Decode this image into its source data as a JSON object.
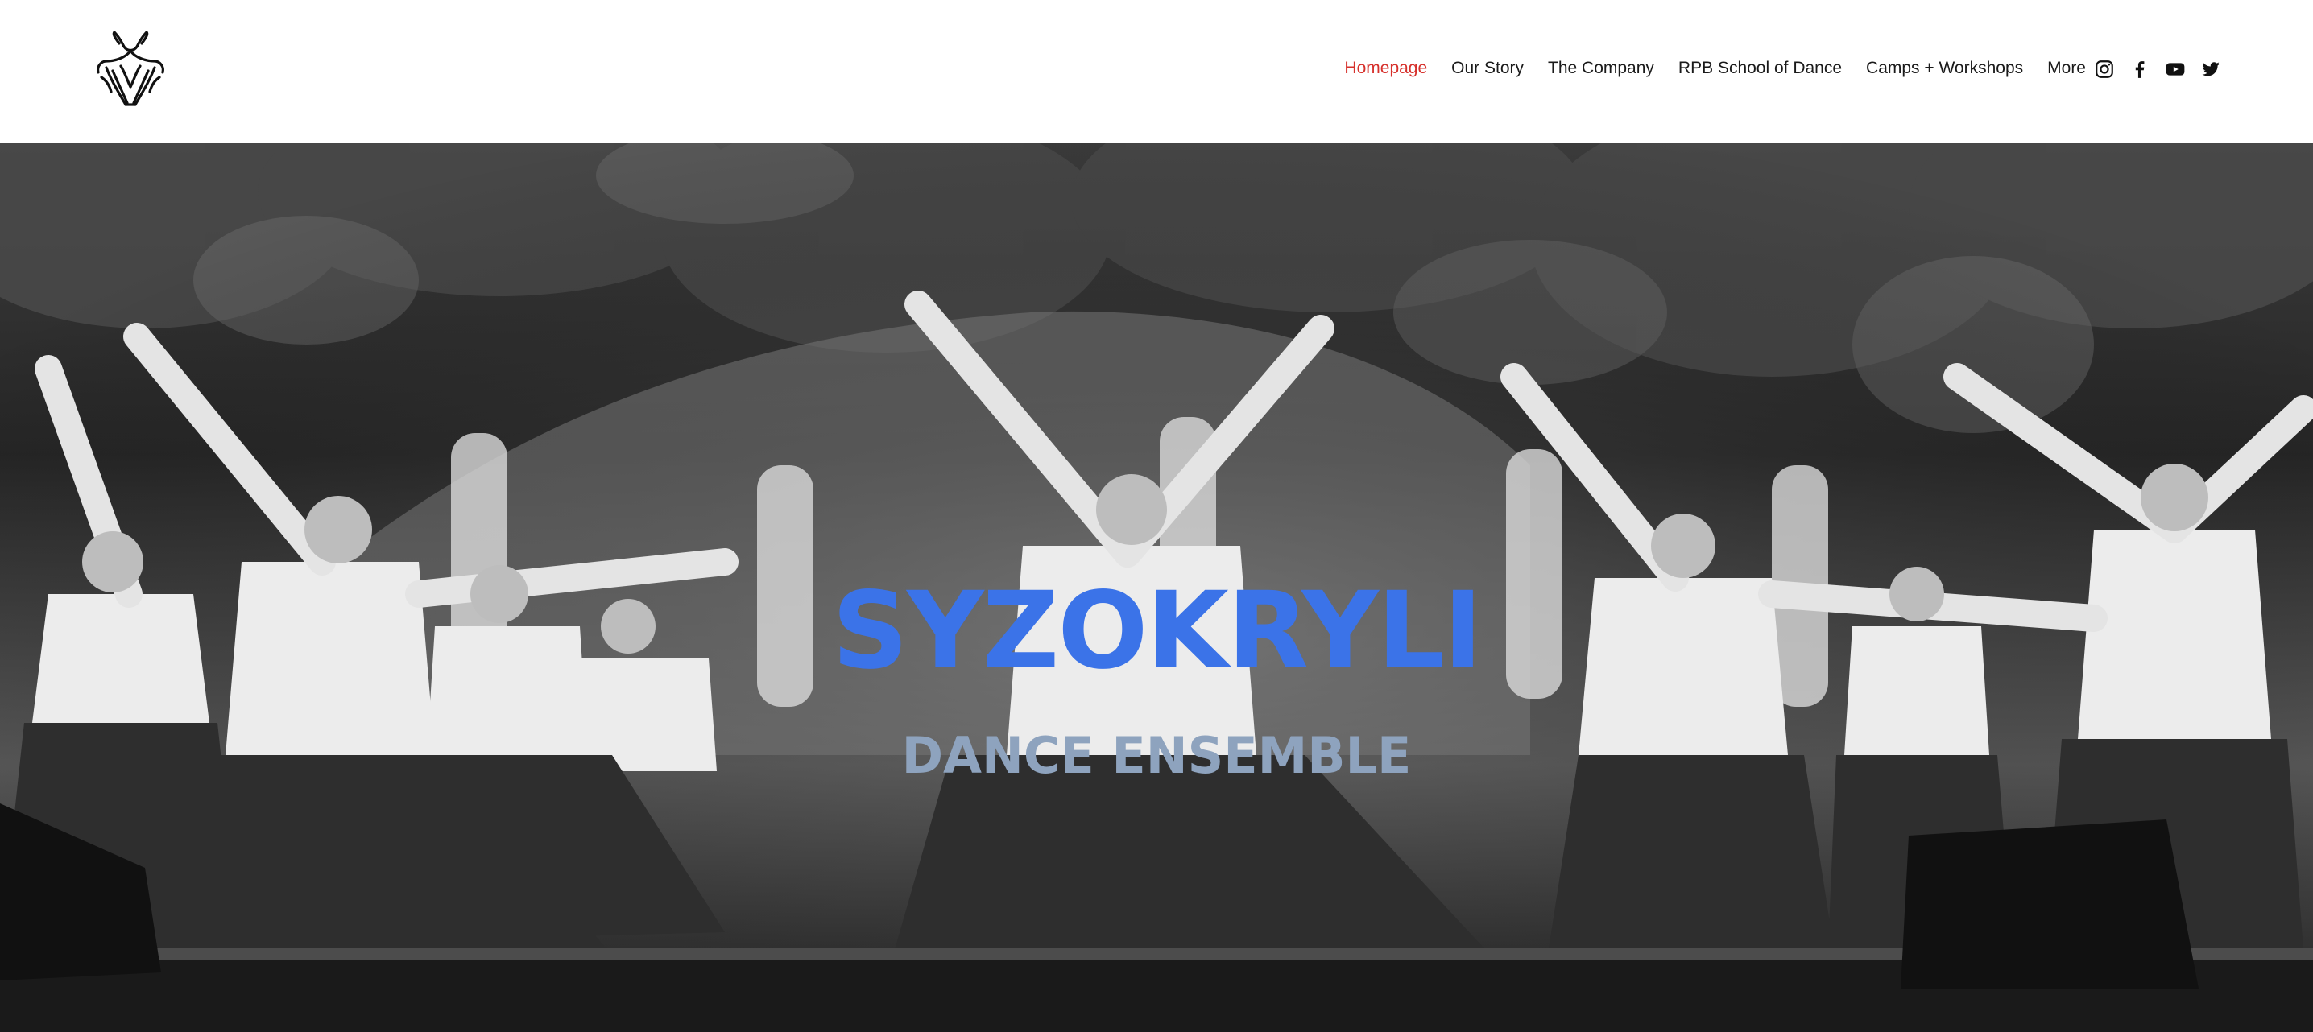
{
  "header": {
    "logo_icon": "dancer-logo-icon",
    "nav": [
      {
        "label": "Homepage",
        "active": true
      },
      {
        "label": "Our Story",
        "active": false
      },
      {
        "label": "The Company",
        "active": false
      },
      {
        "label": "RPB School of Dance",
        "active": false
      },
      {
        "label": "Camps + Workshops",
        "active": false
      },
      {
        "label": "More",
        "active": false
      }
    ],
    "social": [
      "instagram-icon",
      "facebook-icon",
      "youtube-icon",
      "twitter-icon"
    ]
  },
  "hero": {
    "title": "SYZOKRYLI",
    "subtitle": "DANCE ENSEMBLE",
    "image": "black-and-white photo of folk dancers on stage"
  },
  "colors": {
    "nav_active": "#d6302b",
    "nav_text": "#1a1a1a",
    "title": "#3b73e8",
    "subtitle": "#8ea3be"
  }
}
